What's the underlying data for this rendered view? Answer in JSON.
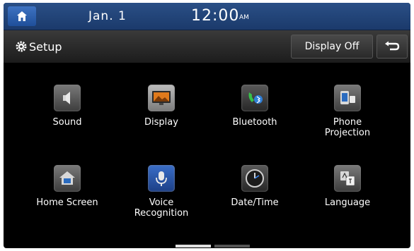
{
  "status": {
    "date": "Jan.  1",
    "time": "12:00",
    "ampm": "AM"
  },
  "header": {
    "title": "Setup",
    "display_off_label": "Display Off"
  },
  "menu": [
    {
      "label": "Sound",
      "icon": "speaker-icon"
    },
    {
      "label": "Display",
      "icon": "monitor-icon"
    },
    {
      "label": "Bluetooth",
      "icon": "bluetooth-phone-icon"
    },
    {
      "label": "Phone\nProjection",
      "icon": "phone-projection-icon"
    },
    {
      "label": "Home Screen",
      "icon": "home-screen-icon"
    },
    {
      "label": "Voice\nRecognition",
      "icon": "microphone-icon"
    },
    {
      "label": "Date/Time",
      "icon": "clock-icon"
    },
    {
      "label": "Language",
      "icon": "language-icon"
    }
  ],
  "pager": {
    "pages": 2,
    "current": 1
  },
  "colors": {
    "statusbar": "#1b3a6b",
    "home_button": "#2f63b2",
    "background": "#000000"
  }
}
